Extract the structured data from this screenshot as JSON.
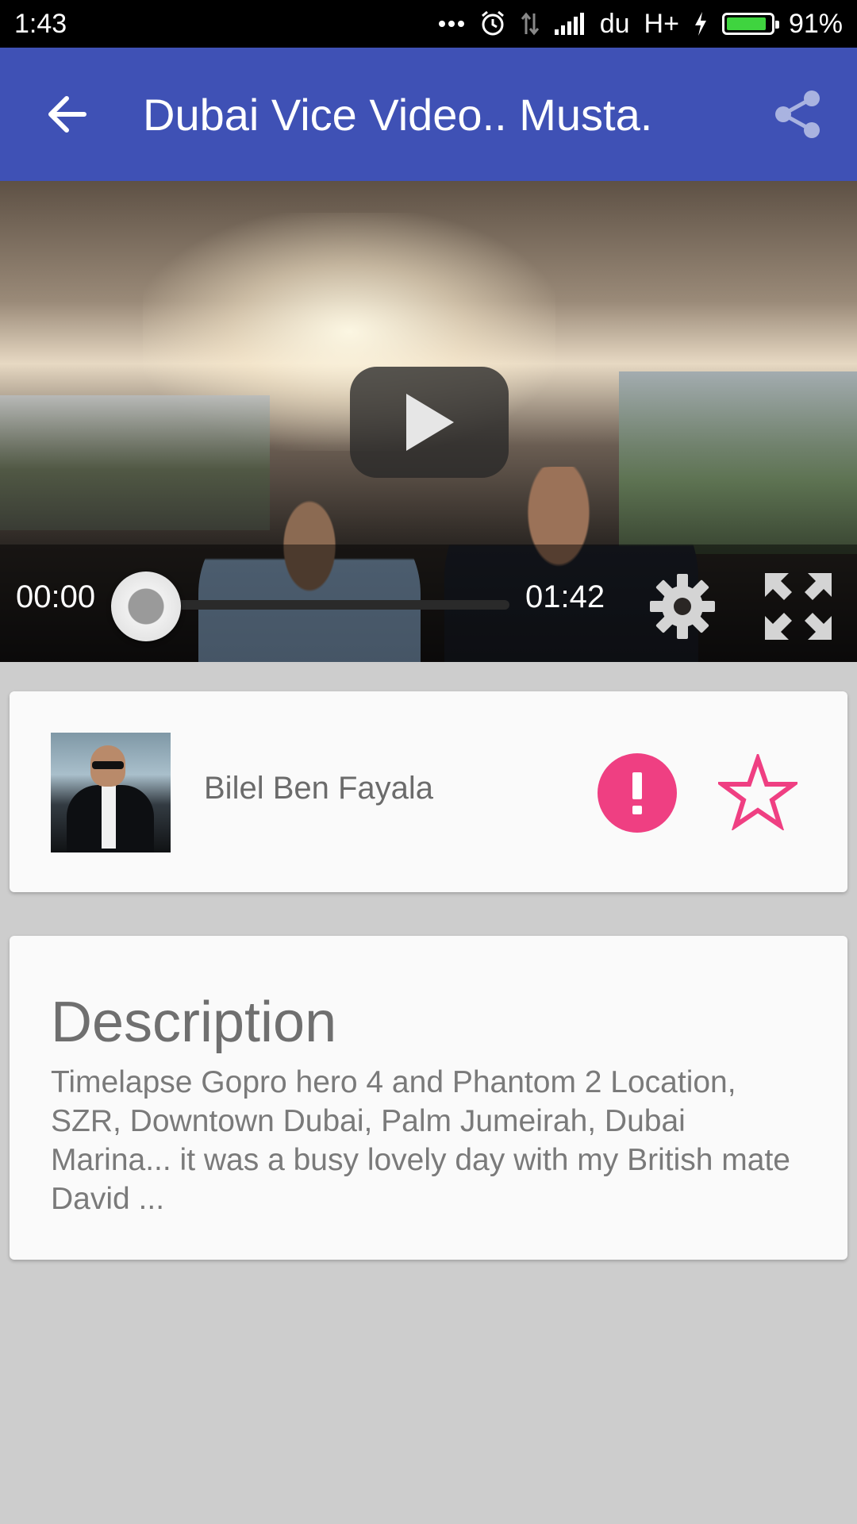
{
  "status_bar": {
    "time": "1:43",
    "carrier": "du",
    "network": "H+",
    "battery_percent": "91%",
    "battery_level": 0.91,
    "icons": [
      "more-icon",
      "alarm-icon",
      "data-arrows-icon",
      "signal-icon",
      "charging-icon",
      "battery-icon"
    ]
  },
  "app_bar": {
    "title": "Dubai Vice Video.. Musta.",
    "back_icon": "arrow-left-icon",
    "share_icon": "share-icon",
    "background": "#3f51b5"
  },
  "player": {
    "current_time": "00:00",
    "total_time": "01:42",
    "progress": 0,
    "play_icon": "play-icon",
    "settings_icon": "gear-icon",
    "fullscreen_icon": "fullscreen-icon"
  },
  "author": {
    "name": "Bilel Ben Fayala",
    "report_icon": "exclamation-icon",
    "favorite_icon": "star-outline-icon",
    "accent": "#ef3f82"
  },
  "description": {
    "title": "Description",
    "body": "Timelapse Gopro hero 4 and Phantom 2 Location, SZR, Downtown Dubai, Palm Jumeirah, Dubai Marina... it was a busy lovely day with my British mate David ..."
  }
}
